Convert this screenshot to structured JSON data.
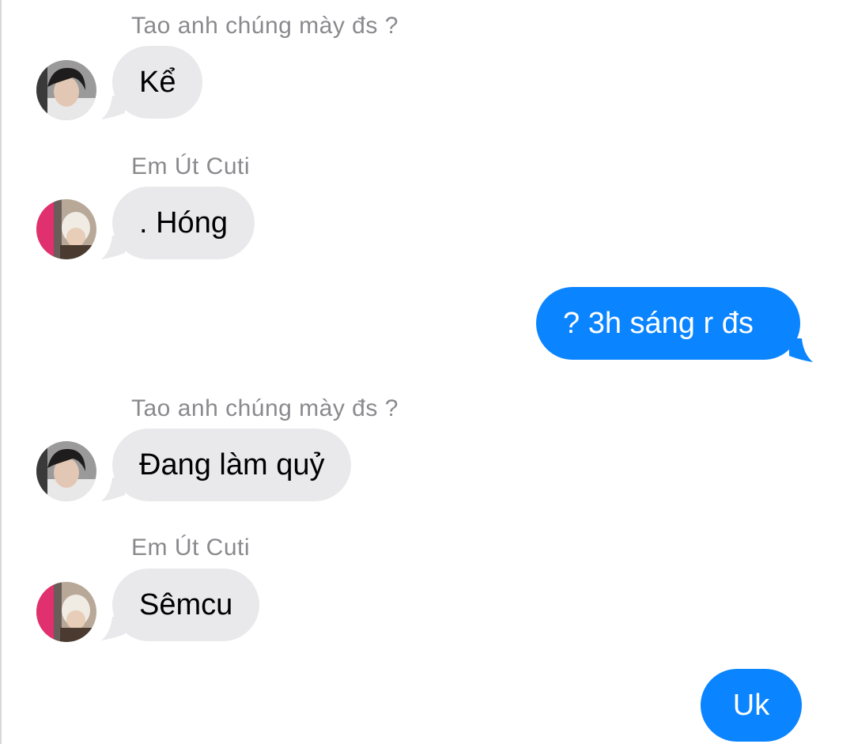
{
  "conversation": {
    "messages": [
      {
        "direction": "incoming",
        "sender": "Tao anh chúng mày đs ?",
        "avatar": "avatar-tao-anh",
        "text": "Kể"
      },
      {
        "direction": "incoming",
        "sender": "Em Út Cuti",
        "avatar": "avatar-em-ut",
        "text": ". Hóng"
      },
      {
        "direction": "outgoing",
        "text": "? 3h sáng r đs"
      },
      {
        "direction": "incoming",
        "sender": "Tao anh chúng mày đs ?",
        "avatar": "avatar-tao-anh",
        "text": "Đang làm quỷ"
      },
      {
        "direction": "incoming",
        "sender": "Em Út Cuti",
        "avatar": "avatar-em-ut",
        "text": "Sêmcu"
      },
      {
        "direction": "outgoing",
        "text": "Uk"
      }
    ]
  },
  "colors": {
    "incoming_bubble": "#e9e9eb",
    "outgoing_bubble": "#0a84ff",
    "sender_name": "#8a8a8e"
  }
}
